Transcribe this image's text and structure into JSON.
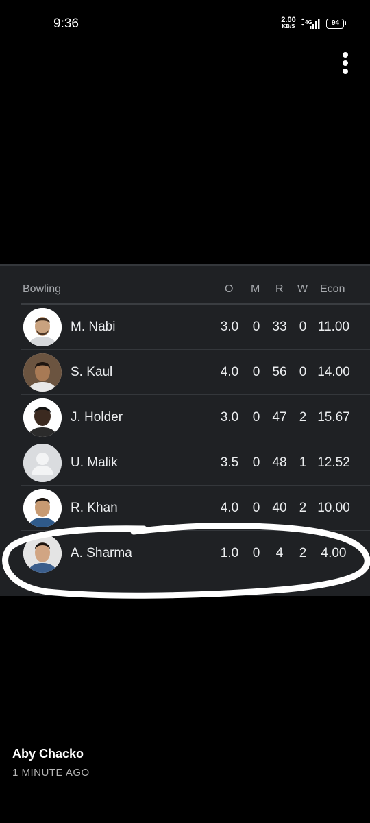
{
  "status_bar": {
    "time": "9:36",
    "net_speed_value": "2.00",
    "net_speed_unit": "KB/S",
    "network": "4G",
    "battery": "94"
  },
  "scorecard": {
    "headers": {
      "bowling": "Bowling",
      "o": "O",
      "m": "M",
      "r": "R",
      "w": "W",
      "econ": "Econ"
    },
    "rows": [
      {
        "name": "M. Nabi",
        "o": "3.0",
        "m": "0",
        "r": "33",
        "w": "0",
        "econ": "11.00"
      },
      {
        "name": "S. Kaul",
        "o": "4.0",
        "m": "0",
        "r": "56",
        "w": "0",
        "econ": "14.00"
      },
      {
        "name": "J. Holder",
        "o": "3.0",
        "m": "0",
        "r": "47",
        "w": "2",
        "econ": "15.67"
      },
      {
        "name": "U. Malik",
        "o": "3.5",
        "m": "0",
        "r": "48",
        "w": "1",
        "econ": "12.52"
      },
      {
        "name": "R. Khan",
        "o": "4.0",
        "m": "0",
        "r": "40",
        "w": "2",
        "econ": "10.00"
      },
      {
        "name": "A. Sharma",
        "o": "1.0",
        "m": "0",
        "r": "4",
        "w": "2",
        "econ": "4.00"
      }
    ]
  },
  "footer": {
    "author": "Aby Chacko",
    "time_ago": "1 MINUTE AGO"
  },
  "colors": {
    "background": "#000000",
    "card": "#1f2124",
    "text": "#eceef0",
    "header_text": "#a6a9ad",
    "highlight": "#ffffff"
  }
}
